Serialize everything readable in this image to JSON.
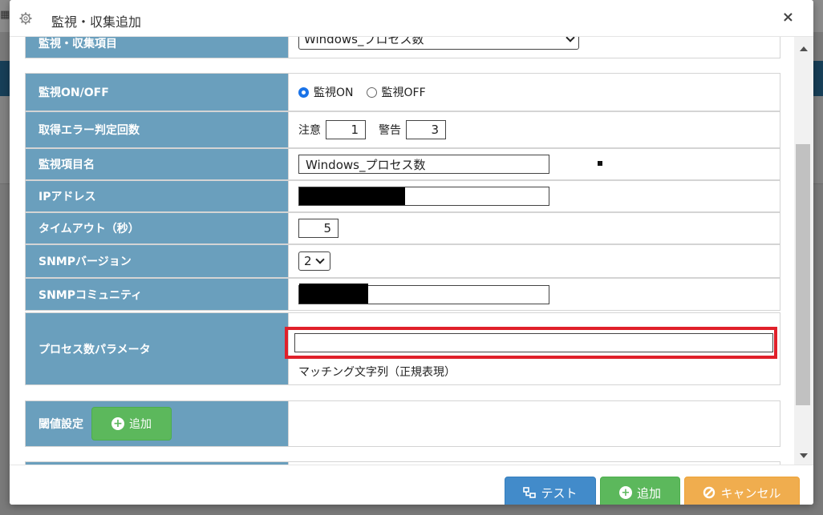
{
  "dialog": {
    "title": "監視・収集追加",
    "close": "×"
  },
  "rows": {
    "item": {
      "label": "監視・収集項目",
      "value": "Windows_プロセス数"
    },
    "monitor": {
      "label": "監視ON/OFF",
      "on": "監視ON",
      "off": "監視OFF",
      "selected": "on"
    },
    "errcount": {
      "label": "取得エラー判定回数",
      "caution_label": "注意",
      "caution_value": "1",
      "warn_label": "警告",
      "warn_value": "3"
    },
    "itemname": {
      "label": "監視項目名",
      "value": "Windows_プロセス数"
    },
    "ip": {
      "label": "IPアドレス"
    },
    "timeout": {
      "label": "タイムアウト（秒）",
      "value": "5"
    },
    "snmpver": {
      "label": "SNMPバージョン",
      "value": "2"
    },
    "community": {
      "label": "SNMPコミュニティ"
    },
    "process": {
      "label": "プロセス数パラメータ",
      "value": "",
      "hint": "マッチング文字列（正規表現）"
    },
    "threshold": {
      "label": "閾値設定",
      "add_button": "追加"
    }
  },
  "footer": {
    "test": "テスト",
    "add": "追加",
    "cancel": "キャンセル"
  },
  "colors": {
    "label_bg": "#6a9fbd",
    "highlight": "#e0202a",
    "success": "#5cb85c",
    "primary": "#428bca",
    "warning": "#f0ad4e"
  }
}
